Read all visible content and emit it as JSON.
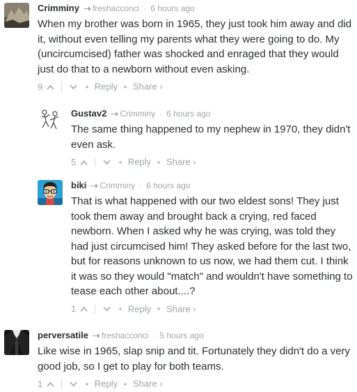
{
  "comments": [
    {
      "author": "Crimminy",
      "parent": "freshacconci",
      "time": "6 hours ago",
      "text": "When my brother was born in 1965, they just took him away and did it, without even telling my parents what they were going to do. My (uncircumcised) father was shocked and enraged that they would just do that to a newborn without even asking.",
      "votes": "9",
      "reply": "Reply",
      "share": "Share ›"
    },
    {
      "author": "Gustav2",
      "parent": "Crimminy",
      "time": "6 hours ago",
      "text": "The same thing happened to my nephew in 1970, they didn't even ask.",
      "votes": "5",
      "reply": "Reply",
      "share": "Share ›"
    },
    {
      "author": "biki",
      "parent": "Crimminy",
      "time": "6 hours ago",
      "text": "That is what happened with our two eldest sons! They just took them away and brought back a crying, red faced newborn. When I asked why he was crying, was told they had just circumcised him! They asked before for the last two, but for reasons unknown to us now, we had them cut. I think it was so they would \"match\" and wouldn't have something to tease each other about....?",
      "votes": "1",
      "reply": "Reply",
      "share": "Share ›"
    },
    {
      "author": "perversatile",
      "parent": "freshacconci",
      "time": "5 hours ago",
      "text": "Like wise in 1965, slap snip and tit. Fortunately they didn't do a very good job, so I get to play for both teams.",
      "votes": "1",
      "reply": "Reply",
      "share": "Share ›"
    }
  ],
  "colors": {
    "text": "#2a2e2e",
    "meta": "#a0a5a7"
  }
}
